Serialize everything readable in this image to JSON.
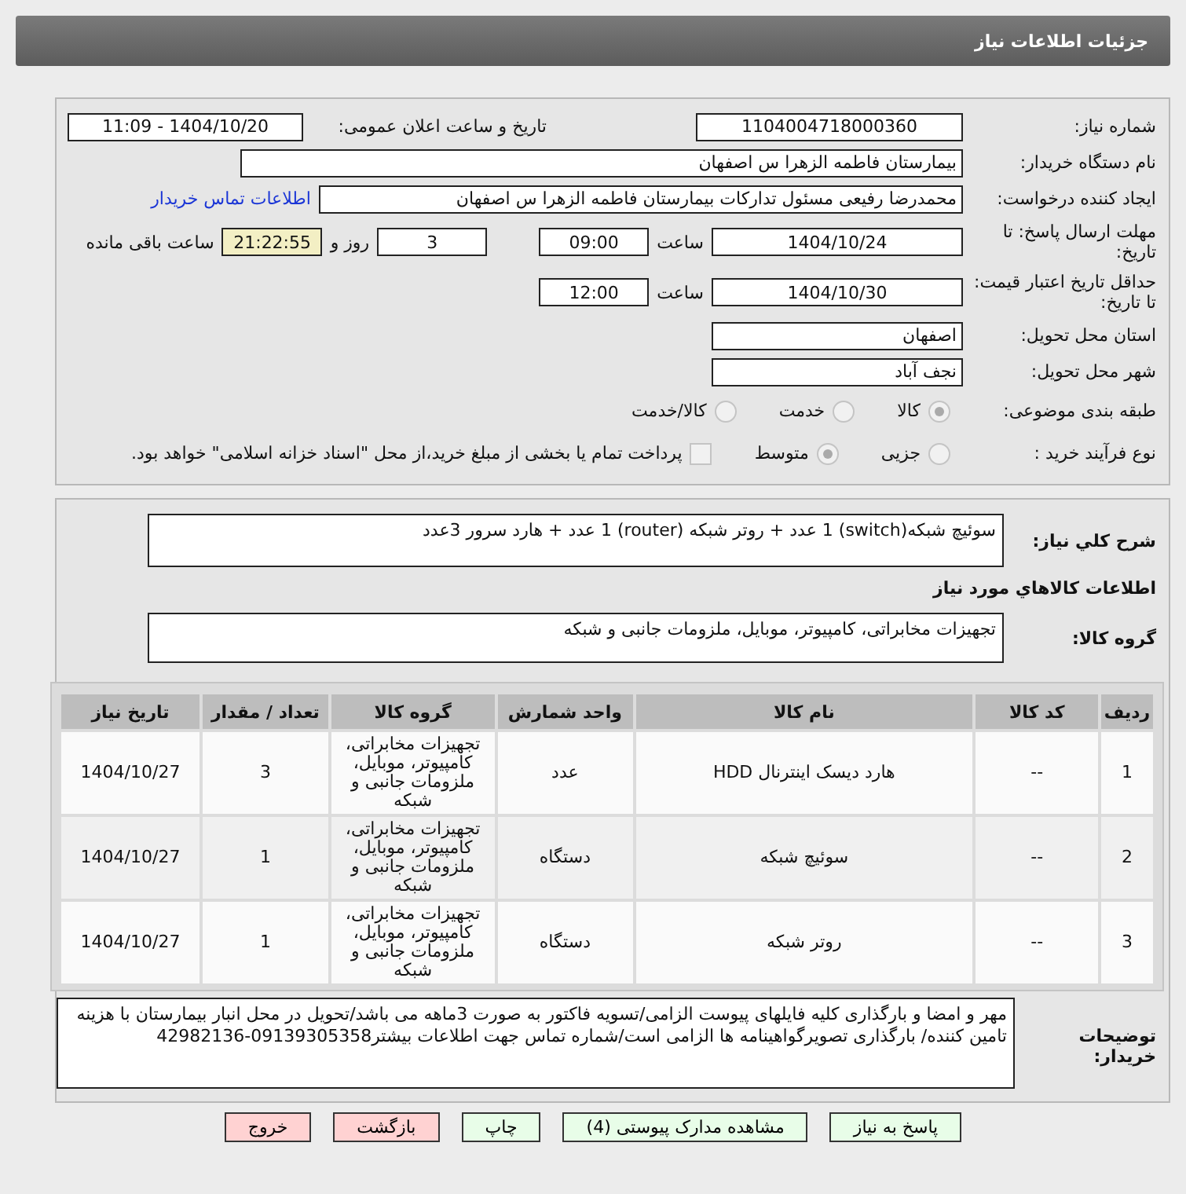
{
  "window": {
    "title": "جزئیات اطلاعات نیاز"
  },
  "need_number": {
    "label": "شماره نیاز:",
    "value": "1104004718000360"
  },
  "announce": {
    "label": "تاریخ و ساعت اعلان عمومی:",
    "value": "1404/10/20 - 11:09"
  },
  "buyer": {
    "label": "نام دستگاه خریدار:",
    "value": "بیمارستان فاطمه الزهرا س  اصفهان"
  },
  "creator": {
    "label": "ایجاد کننده درخواست:",
    "value": "محمدرضا رفیعی مسئول تدارکات بیمارستان فاطمه الزهرا س  اصفهان",
    "link": "اطلاعات تماس خریدار"
  },
  "deadline": {
    "label": "مهلت ارسال پاسخ: تا تاریخ:",
    "date": "1404/10/24",
    "time_label": "ساعت",
    "time": "09:00",
    "days": "3",
    "days_label": "روز و",
    "remaining": "21:22:55",
    "remaining_label": "ساعت باقی مانده"
  },
  "validity": {
    "label": "حداقل تاریخ اعتبار قیمت: تا تاریخ:",
    "date": "1404/10/30",
    "time_label": "ساعت",
    "time": "12:00"
  },
  "province": {
    "label": "استان محل تحویل:",
    "value": "اصفهان"
  },
  "city": {
    "label": "شهر محل تحویل:",
    "value": "نجف آباد"
  },
  "category": {
    "label": "طبقه بندی موضوعی:",
    "options": [
      {
        "label": "کالا",
        "selected": true
      },
      {
        "label": "خدمت",
        "selected": false
      },
      {
        "label": "کالا/خدمت",
        "selected": false
      }
    ]
  },
  "process": {
    "label": "نوع فرآیند خرید :",
    "options": [
      {
        "label": "جزیی",
        "selected": false
      },
      {
        "label": "متوسط",
        "selected": true
      }
    ],
    "payment": {
      "label": "پرداخت تمام یا بخشی از مبلغ خرید،از محل \"اسناد خزانه اسلامی\" خواهد بود.",
      "checked": false
    }
  },
  "description": {
    "label": "شرح کلي نیاز:",
    "value": "سوئیچ شبکه(switch) 1 عدد + روتر شبکه (router) 1 عدد + هارد سرور 3عدد"
  },
  "goods_heading": "اطلاعات کالاهاي مورد نیاز",
  "goods_group": {
    "label": "گروه کالا:",
    "value": "تجهیزات مخابراتی، کامپیوتر، موبایل، ملزومات جانبی و شبکه"
  },
  "table": {
    "columns": [
      "ردیف",
      "کد کالا",
      "نام کالا",
      "واحد شمارش",
      "گروه کالا",
      "تعداد / مقدار",
      "تاریخ نیاز"
    ],
    "rows": [
      [
        "1",
        "--",
        "هارد دیسک اینترنال HDD",
        "عدد",
        "تجهیزات مخابراتی، کامپیوتر، موبایل، ملزومات جانبی و شبکه",
        "3",
        "1404/10/27"
      ],
      [
        "2",
        "--",
        "سوئیچ شبکه",
        "دستگاه",
        "تجهیزات مخابراتی، کامپیوتر، موبایل، ملزومات جانبی و شبکه",
        "1",
        "1404/10/27"
      ],
      [
        "3",
        "--",
        "روتر شبکه",
        "دستگاه",
        "تجهیزات مخابراتی، کامپیوتر، موبایل، ملزومات جانبی و شبکه",
        "1",
        "1404/10/27"
      ]
    ]
  },
  "notes": {
    "label": "توضیحات خریدار:",
    "value": "مهر و امضا و بارگذاری کلیه فایلهای پیوست الزامی/تسویه فاکتور  به صورت 3ماهه می باشد/تحویل در محل انبار بیمارستان با هزینه تامین کننده/ بارگذاری تصویرگواهینامه ها الزامی است/شماره تماس جهت اطلاعات بیشتر09139305358-42982136"
  },
  "buttons": [
    {
      "label": "پاسخ به نیاز",
      "kind": "normal"
    },
    {
      "label": "مشاهده مدارک پیوستی (4)",
      "kind": "normal"
    },
    {
      "label": "چاپ",
      "kind": "normal"
    },
    {
      "label": "بازگشت",
      "kind": "danger"
    },
    {
      "label": "خروج",
      "kind": "danger"
    }
  ]
}
